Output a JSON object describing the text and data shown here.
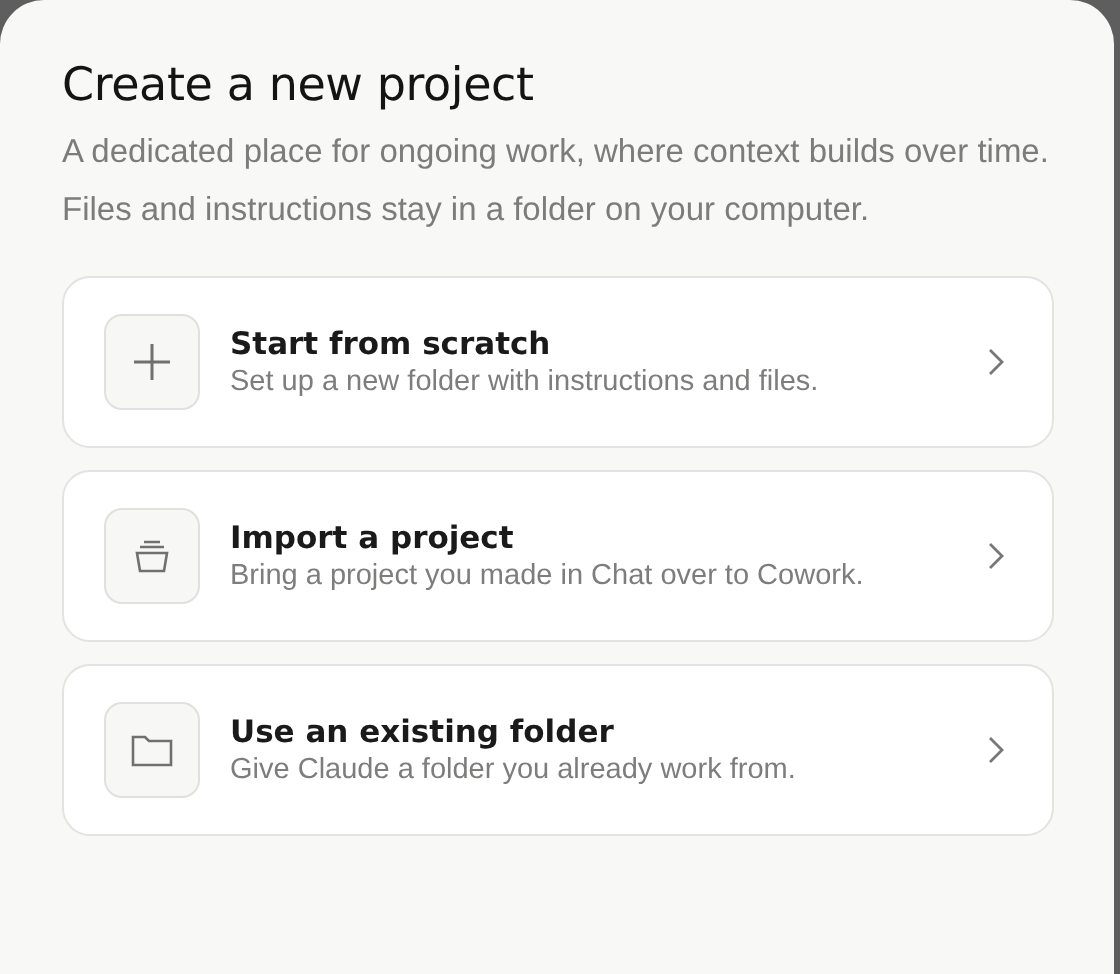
{
  "dialog": {
    "title": "Create a new project",
    "description": "A dedicated place for ongoing work, where context builds over time. Files and instructions stay in a folder on your computer."
  },
  "options": [
    {
      "kind": "plus",
      "title": "Start from scratch",
      "subtitle": "Set up a new folder with instructions and files."
    },
    {
      "kind": "import",
      "title": "Import a project",
      "subtitle": "Bring a project you made in Chat over to Cowork."
    },
    {
      "kind": "folder",
      "title": "Use an existing folder",
      "subtitle": "Give Claude a folder you already work from."
    }
  ]
}
